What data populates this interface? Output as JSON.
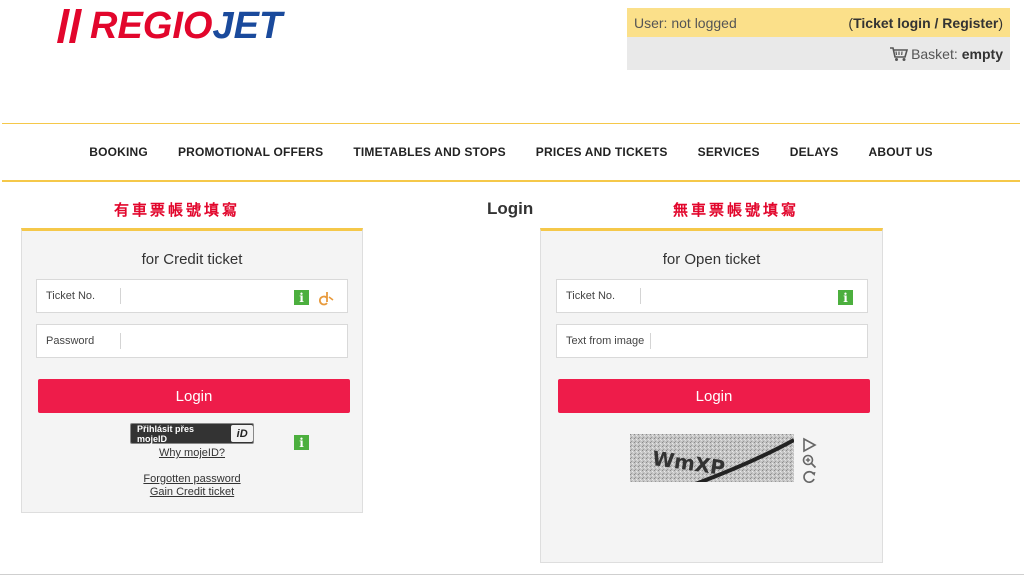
{
  "logo": {
    "regio": "REGIO",
    "jet": "JET"
  },
  "user": {
    "status": "User: not logged",
    "auth_open": "(",
    "auth_link": "Ticket login / Register",
    "auth_close": ")",
    "basket_label": "Basket:",
    "basket_value": "empty"
  },
  "nav": {
    "items": [
      "BOOKING",
      "PROMOTIONAL OFFERS",
      "TIMETABLES AND STOPS",
      "PRICES AND TICKETS",
      "SERVICES",
      "DELAYS",
      "ABOUT US"
    ]
  },
  "annotations": {
    "left": "有車票帳號填寫",
    "right": "無車票帳號填寫"
  },
  "page_title": "Login",
  "credit": {
    "heading": "for Credit ticket",
    "ticket_label": "Ticket No.",
    "password_label": "Password",
    "login_button": "Login",
    "mojeid_button": "Přihlásit přes mojeID",
    "mojeid_badge": "iD",
    "why_mojeid": "Why mojeID?",
    "forgotten_password": "Forgotten password",
    "gain_credit": "Gain Credit ticket"
  },
  "open": {
    "heading": "for Open ticket",
    "ticket_label": "Ticket No.",
    "captcha_label": "Text from image",
    "login_button": "Login",
    "captcha_text": "WmXP"
  },
  "colors": {
    "accent": "#ee1c4a",
    "border": "#f5c84a",
    "info": "#4caf3e"
  }
}
